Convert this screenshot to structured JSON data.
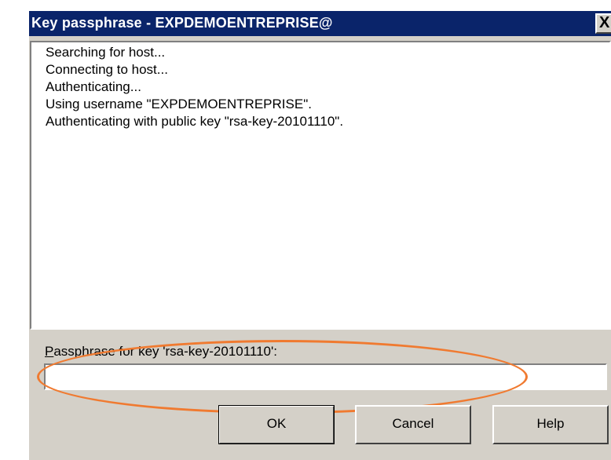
{
  "window": {
    "title": "Key passphrase - EXPDEMOENTREPRISE@",
    "close_label": "X"
  },
  "log": {
    "lines": [
      "Searching for host...",
      "Connecting to host...",
      "Authenticating...",
      "Using username \"EXPDEMOENTREPRISE\".",
      "Authenticating with public key \"rsa-key-20101110\"."
    ]
  },
  "passphrase": {
    "label_accel": "P",
    "label_rest": "assphrase for key 'rsa-key-20101110':",
    "value": "",
    "highlight_color": "#f07a30"
  },
  "buttons": {
    "ok": "OK",
    "cancel": "Cancel",
    "help": "Help"
  },
  "colors": {
    "titlebar": "#0a246a",
    "dialog_bg": "#d4d0c8"
  }
}
